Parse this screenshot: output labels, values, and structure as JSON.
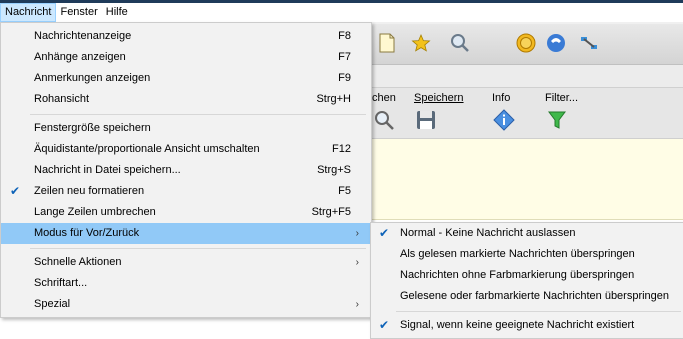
{
  "menubar": {
    "items": [
      {
        "label": "Nachricht",
        "active": true
      },
      {
        "label": "Fenster",
        "active": false
      },
      {
        "label": "Hilfe",
        "active": false
      }
    ]
  },
  "toolbar2": {
    "buttons": [
      "chen",
      "Speichern",
      "Info",
      "Filter..."
    ]
  },
  "menu": {
    "items": [
      {
        "label": "Nachrichtenanzeige",
        "shortcut": "F8"
      },
      {
        "label": "Anhänge anzeigen",
        "shortcut": "F7"
      },
      {
        "label": "Anmerkungen anzeigen",
        "shortcut": "F9"
      },
      {
        "label": "Rohansicht",
        "shortcut": "Strg+H"
      },
      {
        "label": "Fenstergröße speichern",
        "shortcut": ""
      },
      {
        "label": "Äquidistante/proportionale Ansicht umschalten",
        "shortcut": "F12"
      },
      {
        "label": "Nachricht in Datei speichern...",
        "shortcut": "Strg+S"
      },
      {
        "label": "Zeilen neu formatieren",
        "shortcut": "F5",
        "checked": true
      },
      {
        "label": "Lange Zeilen umbrechen",
        "shortcut": "Strg+F5"
      },
      {
        "label": "Modus für Vor/Zurück",
        "shortcut": "",
        "submenu": true,
        "highlighted": true
      },
      {
        "label": "Schnelle Aktionen",
        "shortcut": "",
        "submenu": true
      },
      {
        "label": "Schriftart...",
        "shortcut": ""
      },
      {
        "label": "Spezial",
        "shortcut": "",
        "submenu": true
      }
    ]
  },
  "submenu": {
    "items": [
      {
        "label": "Normal - Keine Nachricht auslassen",
        "checked": true
      },
      {
        "label": "Als gelesen markierte Nachrichten überspringen",
        "checked": false
      },
      {
        "label": "Nachrichten ohne Farbmarkierung überspringen",
        "checked": false
      },
      {
        "label": "Gelesene oder farbmarkierte Nachrichten überspringen",
        "checked": false
      },
      {
        "label": "Signal, wenn keine geeignete Nachricht existiert",
        "checked": true
      }
    ]
  },
  "background": {
    "dashes": "--"
  },
  "icons": {
    "check": "check-icon",
    "submenu_arrow": "chevron-right-icon"
  },
  "colors": {
    "highlight": "#91c9f7",
    "check": "#0e63b8",
    "menubar_active": "#cce8ff"
  }
}
